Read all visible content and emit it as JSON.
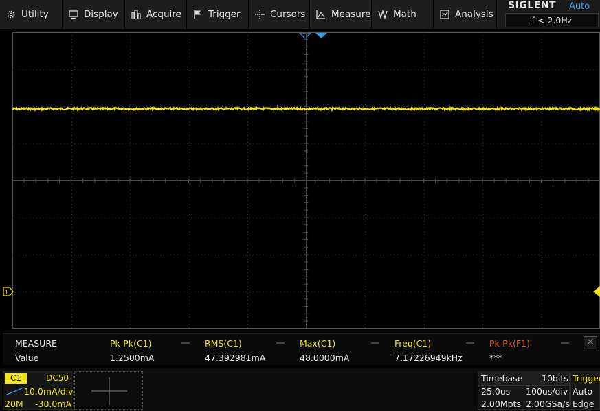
{
  "menu": {
    "items": [
      {
        "label": "Utility",
        "icon": "gear-icon"
      },
      {
        "label": "Display",
        "icon": "monitor-icon"
      },
      {
        "label": "Acquire",
        "icon": "acquire-icon"
      },
      {
        "label": "Trigger",
        "icon": "flag-icon"
      },
      {
        "label": "Cursors",
        "icon": "crosshair-icon"
      },
      {
        "label": "Measure",
        "icon": "measure-icon"
      },
      {
        "label": "Math",
        "icon": "math-icon"
      },
      {
        "label": "Analysis",
        "icon": "analysis-icon"
      }
    ]
  },
  "brand": {
    "logo": "SIGLENT",
    "trigger_mode": "Auto",
    "frequency": "f < 2.0Hz"
  },
  "colors": {
    "channel1": "#f3e31a",
    "accent": "#2ea0e6",
    "math": "#e0642a",
    "grid": "#3a3a3a"
  },
  "measure": {
    "title": "MEASURE",
    "row_label": "Value",
    "columns": [
      {
        "header": "Pk-Pk(C1)",
        "value": "1.2500mA"
      },
      {
        "header": "RMS(C1)",
        "value": "47.392981mA"
      },
      {
        "header": "Max(C1)",
        "value": "48.0000mA"
      },
      {
        "header": "Freq(C1)",
        "value": "7.17226949kHz"
      },
      {
        "header": "Pk-Pk(F1)",
        "value": "***"
      }
    ],
    "close": "✕"
  },
  "channel1": {
    "tag": "C1",
    "coupling": "DC50",
    "scale": "10.0mA/div",
    "bandwidth": "20M",
    "offset": "-30.0mA"
  },
  "timebase": {
    "title": "Timebase",
    "bits": "10bits",
    "delay": "25.0us",
    "scale": "100us/div",
    "memory": "2.00Mpts",
    "sample_rate": "2.00GSa/s"
  },
  "trigger": {
    "title": "Trigger",
    "mode": "Auto",
    "type": "Edge"
  },
  "waveform": {
    "channel": "C1",
    "level_div": 2.05
  }
}
